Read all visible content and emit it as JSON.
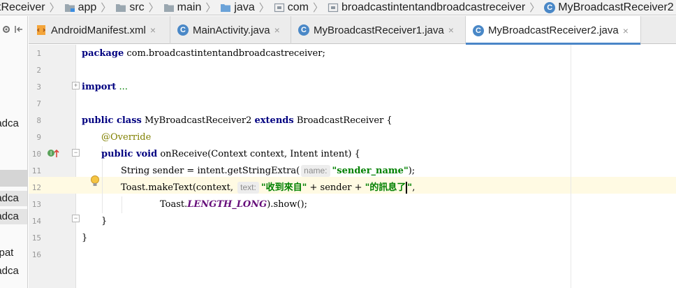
{
  "breadcrumb": [
    {
      "label": "tReceiver",
      "icon": "none"
    },
    {
      "label": "app",
      "icon": "module-folder-icon"
    },
    {
      "label": "src",
      "icon": "folder-icon"
    },
    {
      "label": "main",
      "icon": "folder-icon"
    },
    {
      "label": "java",
      "icon": "source-folder-icon"
    },
    {
      "label": "com",
      "icon": "package-icon"
    },
    {
      "label": "broadcastintentandbroadcastreceiver",
      "icon": "package-icon"
    },
    {
      "label": "MyBroadcastReceiver2",
      "icon": "class-icon"
    }
  ],
  "left_panel": {
    "items": [
      "oadca",
      "oadca",
      "oadca",
      "mpat",
      "oadca"
    ]
  },
  "tabs": [
    {
      "label": "AndroidManifest.xml",
      "close": "×",
      "icon": "xml-file-icon",
      "active": false
    },
    {
      "label": "MainActivity.java",
      "close": "×",
      "icon": "class-icon",
      "active": false
    },
    {
      "label": "MyBroadcastReceiver1.java",
      "close": "×",
      "icon": "class-icon",
      "active": false
    },
    {
      "label": "MyBroadcastReceiver2.java",
      "close": "×",
      "icon": "class-icon",
      "active": true
    }
  ],
  "class_icon_letter": "C",
  "editor": {
    "line_numbers": [
      "1",
      "2",
      "3",
      "7",
      "8",
      "9",
      "10",
      "11",
      "12",
      "13",
      "14",
      "15",
      "16"
    ],
    "code": {
      "l1_kw": "package",
      "l1_rest": " com.broadcastintentandbroadcastreceiver;",
      "l3_kw": "import",
      "l3_dots": " ...",
      "l8_kw1": "public class",
      "l8_name": " MyBroadcastReceiver2 ",
      "l8_kw2": "extends",
      "l8_rest": " BroadcastReceiver {",
      "l9_annotation": "@Override",
      "l10_kw": "public void",
      "l10_rest": " onReceive(Context context, Intent intent) {",
      "l11_pre": "String sender = intent.getStringExtra(",
      "l11_hint": "name:",
      "l11_str": "\"sender_name\"",
      "l11_post": ");",
      "l12_pre": "Toast.makeText(context, ",
      "l12_hint": "text:",
      "l12_str1": "\"收到來自\"",
      "l12_mid": " + sender + ",
      "l12_str2a": "\"的訊息了",
      "l12_str2b": "\"",
      "l12_post": ",",
      "l13_pre": "Toast.",
      "l13_field": "LENGTH_LONG",
      "l13_post": ").show();",
      "l14": "}",
      "l15": "}"
    }
  },
  "colors": {
    "keyword": "#000080",
    "string": "#008000",
    "annotation": "#808000",
    "static_field": "#660e7a",
    "active_tab_underline": "#4a86c8",
    "current_line": "#fffae3"
  }
}
